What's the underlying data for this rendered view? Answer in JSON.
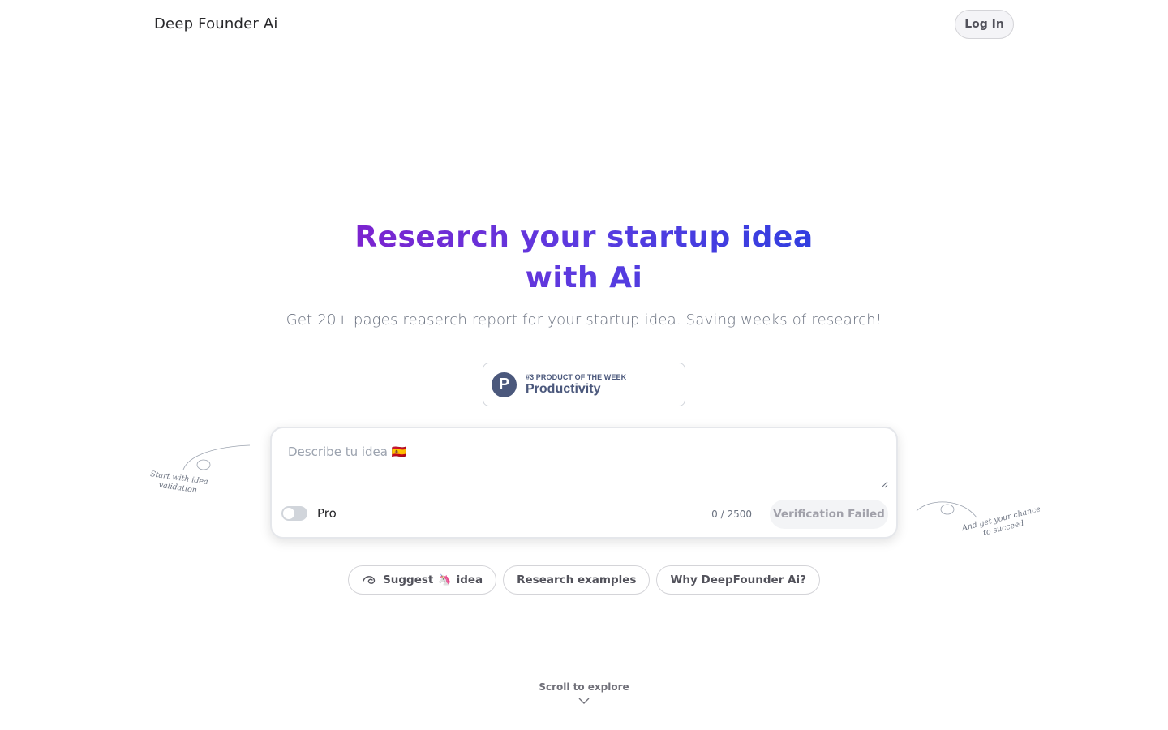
{
  "header": {
    "brand": "Deep Founder Ai",
    "login_label": "Log In"
  },
  "hero": {
    "title": "Research your startup idea with Ai",
    "subtitle": "Get 20+ pages reaserch report for your startup idea. Saving weeks of research!"
  },
  "badge": {
    "logo_letter": "P",
    "kicker": "#3 PRODUCT OF THE WEEK",
    "name": "Productivity"
  },
  "idea_form": {
    "placeholder": "Describe tu idea 🇪🇸",
    "value": "",
    "pro_label": "Pro",
    "pro_enabled": false,
    "char_count": "0 / 2500",
    "submit_label": "Verification Failed"
  },
  "annotations": {
    "left": "Start with idea validation",
    "right": "And get your chance to succeed"
  },
  "pills": {
    "suggest_prefix": "Suggest",
    "suggest_emoji": "🦄",
    "suggest_suffix": "idea",
    "examples": "Research examples",
    "why": "Why DeepFounder Ai?"
  },
  "scroll": {
    "label": "Scroll to explore"
  },
  "icons": {
    "suggest": "spark-loop-icon",
    "scroll": "chevron-down-icon",
    "resize": "resize-grip-icon"
  },
  "colors": {
    "gradient_start": "#7e22ce",
    "gradient_end": "#2f3fe0",
    "badge": "#4b587c"
  }
}
